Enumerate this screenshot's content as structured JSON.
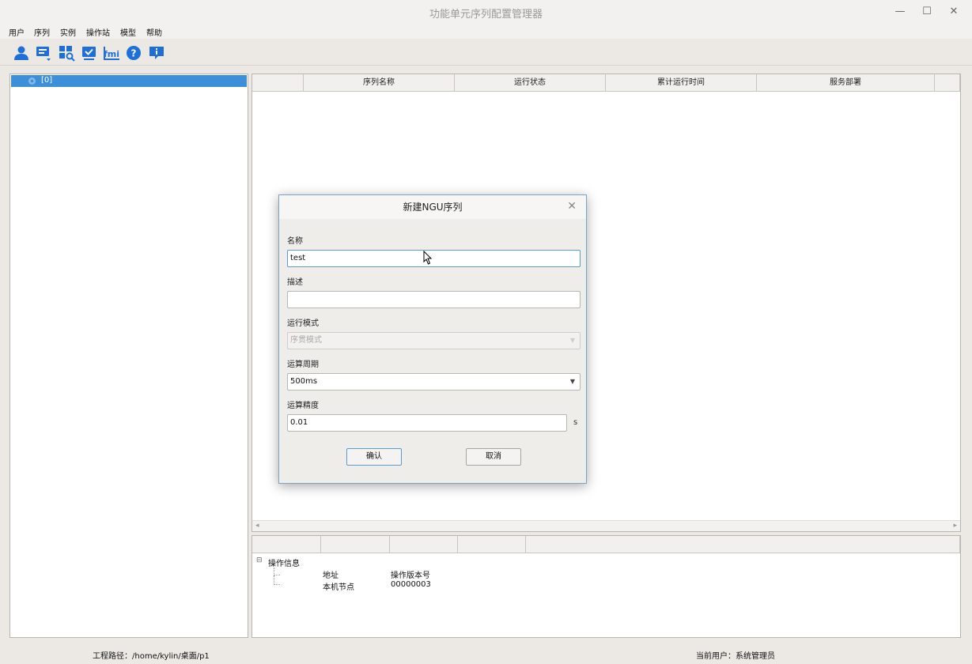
{
  "window": {
    "title": "功能单元序列配置管理器"
  },
  "menu": [
    {
      "label": "用户"
    },
    {
      "label": "序列"
    },
    {
      "label": "实例"
    },
    {
      "label": "操作站"
    },
    {
      "label": "模型"
    },
    {
      "label": "帮助"
    }
  ],
  "toolbar": {
    "fmi_label": "fmi"
  },
  "tree": {
    "selected_node": "[0]"
  },
  "table": {
    "columns": [
      "",
      "序列名称",
      "运行状态",
      "累计运行时间",
      "服务部署"
    ]
  },
  "info_panel": {
    "root_label": "操作信息",
    "rows": [
      {
        "key": "地址",
        "value": "操作版本号"
      },
      {
        "key": "本机节点",
        "value": "00000003"
      }
    ]
  },
  "status": {
    "project_path": "工程路径：/home/kylin/桌面/p1",
    "current_user": "当前用户：系统管理员"
  },
  "dialog": {
    "title": "新建NGU序列",
    "name_label": "名称",
    "name_value": "test",
    "desc_label": "描述",
    "desc_value": "",
    "mode_label": "运行模式",
    "mode_value": "序贯模式",
    "cycle_label": "运算周期",
    "cycle_value": "500ms",
    "precision_label": "运算精度",
    "precision_value": "0.01",
    "precision_unit": "s",
    "ok_label": "确认",
    "cancel_label": "取消"
  }
}
